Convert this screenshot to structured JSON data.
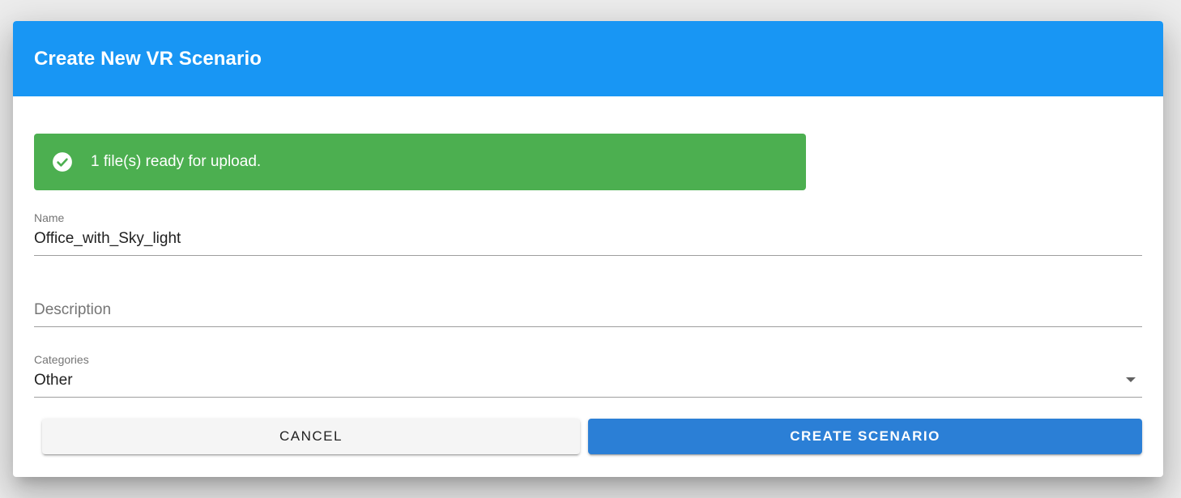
{
  "dialog": {
    "title": "Create New VR Scenario"
  },
  "alert": {
    "icon": "check-circle-icon",
    "message": "1 file(s) ready for upload.",
    "color": "#4caf50"
  },
  "form": {
    "name": {
      "label": "Name",
      "value": "Office_with_Sky_light"
    },
    "description": {
      "placeholder": "Description",
      "value": ""
    },
    "categories": {
      "label": "Categories",
      "selected": "Other",
      "icon": "chevron-down-icon"
    }
  },
  "actions": {
    "cancel_label": "CANCEL",
    "create_label": "CREATE SCENARIO"
  },
  "colors": {
    "header": "#1896f4",
    "primary_button": "#2b7fd6",
    "cancel_button": "#f5f5f5"
  }
}
